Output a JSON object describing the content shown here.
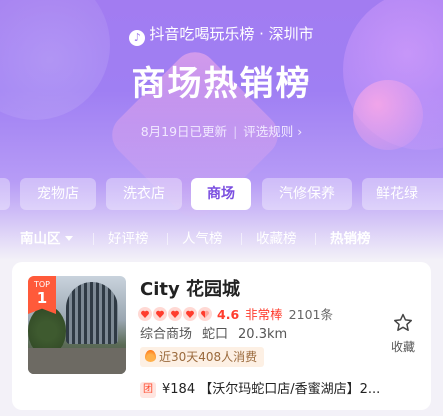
{
  "header": {
    "brand": "抖音吃喝玩乐榜 · 深圳市",
    "title": "商场热销榜",
    "updated": "8月19日已更新",
    "rules": "评选规则"
  },
  "categories": [
    {
      "label": "宠物店",
      "active": false
    },
    {
      "label": "洗衣店",
      "active": false
    },
    {
      "label": "商场",
      "active": true
    },
    {
      "label": "汽修保养",
      "active": false
    },
    {
      "label": "鲜花绿",
      "active": false
    }
  ],
  "filters": {
    "district": "南山区",
    "tabs": [
      "好评榜",
      "人气榜",
      "收藏榜",
      "热销榜"
    ],
    "active_tab": "热销榜"
  },
  "listing": {
    "rank_badge_top": "TOP",
    "rank": "1",
    "name": "City 花园城",
    "hearts": 5,
    "score": "4.6",
    "level": "非常棒",
    "reviews": "2101条",
    "category": "综合商场",
    "area": "蛇口",
    "distance": "20.3km",
    "consume": "近30天408人消费",
    "deal_tag": "团",
    "deal_text": "¥184 【沃尔玛蛇口店/香蜜湖店】2...",
    "fav_label": "收藏"
  },
  "colors": {
    "accent": "#7b4fe0",
    "rating_red": "#ff3d2e"
  }
}
